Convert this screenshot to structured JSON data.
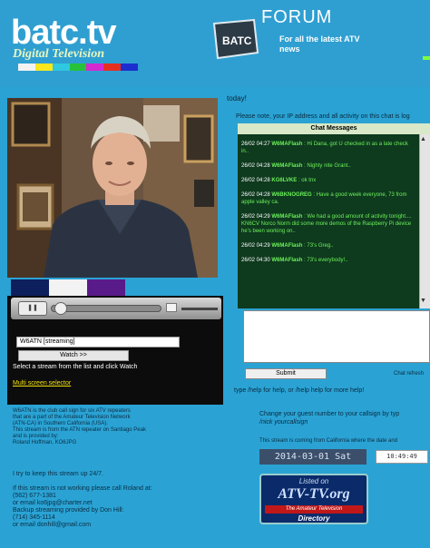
{
  "header": {
    "logo_text": "batc.tv",
    "logo_subtitle": "Digital Television",
    "colorbar": [
      "#f2f2f2",
      "#f7e71c",
      "#2ec8e0",
      "#27c23a",
      "#d52ad0",
      "#e53020",
      "#1c2ed0"
    ],
    "forum_badge": "BATC",
    "forum_title": "FORUM",
    "forum_tagline": "For all the latest ATV news"
  },
  "video": {
    "swatches": [
      "#0d1f5c",
      "#f3f3f3",
      "#5a1b8a"
    ],
    "stream_option": "W6ATN [streaming]",
    "watch_button": "Watch >>",
    "watch_hint": "Select a stream from the list and click Watch",
    "multi_screen_link": "Multi screen selector"
  },
  "info": {
    "top_lines": [
      "W6ATN is the club call sign for six ATV repeaters",
      "that are a part of the Amateur Television Network",
      "(ATN-CA) in Southern California (USA).",
      "This stream is from the ATN repeater on Santiago Peak",
      "and is provided by:",
      "Roland Hoffman, KO6JPG"
    ],
    "keep_up": "I try to keep this stream up 24/7.",
    "contact_lines": [
      "If this stream is not working please call Roland at:",
      "(562) 677-1381",
      "or email ko6jpg@charter.net",
      "Backup streaming provided by Don Hill:",
      "(714) 345-1114",
      "or email donhill@gmail.com"
    ]
  },
  "chat": {
    "today_text": "today!",
    "ip_note": "Please note, your IP address and all activity on this chat is log",
    "header": "Chat Messages",
    "messages": [
      {
        "dt": "26/02 04:27",
        "name": "W6MAFlash",
        "text": " : Hi Dana, got U checked in as a late check in.."
      },
      {
        "dt": "26/02 04:28",
        "name": "W6MAFlash",
        "text": " : Nighty nite Grant.."
      },
      {
        "dt": "26/02 04:28",
        "name": "KG6LVKE",
        "text": " : ok tnx"
      },
      {
        "dt": "26/02 04:28",
        "name": "W6BKNOGREG",
        "text": " : Have a good week everyone, 73 from apple valley ca."
      },
      {
        "dt": "26/02 04:29",
        "name": "W6MAFlash",
        "text": " : We had a good amount of activity tonight.... KN6CV Norco Norm did some more demos of the Raspberry Pi device he's been working on.."
      },
      {
        "dt": "26/02 04:29",
        "name": "W6MAFlash",
        "text": " : 73's Greg.."
      },
      {
        "dt": "26/02 04:30",
        "name": "W6MAFlash",
        "text": " : 73's everybody!.."
      }
    ],
    "submit_label": "Submit",
    "refresh_label": "Chat refresh",
    "help_text": "type /help for help, or /help help for more help!",
    "callsign_line1": "Change your guest number to your callsign by typ",
    "callsign_line2": "/nick yourcallsign",
    "coming_from": "This stream is coming from California where the date and",
    "date": "2014-03-01  Sat",
    "time": "10:49:49"
  },
  "atv_banner": {
    "listed": "Listed on",
    "name": "ATV-TV.org",
    "red_strip": "The Amateur Television",
    "directory": "Directory"
  }
}
